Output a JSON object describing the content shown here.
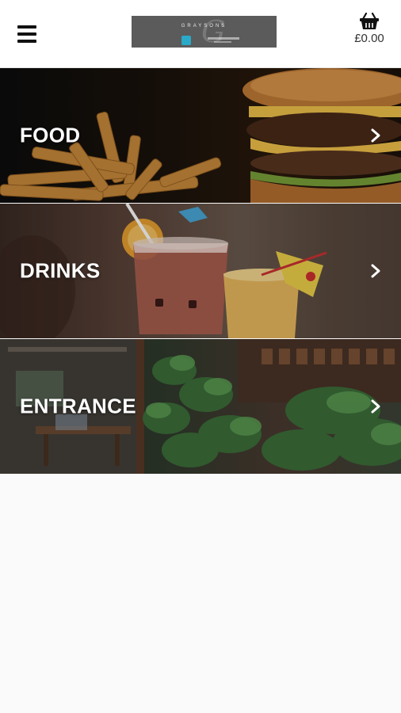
{
  "header": {
    "logo_name": "GRAYSONS",
    "logo_mark": "G",
    "basket_total": "£0.00"
  },
  "categories": [
    {
      "label": "FOOD",
      "icon": "chevron-right-icon"
    },
    {
      "label": "DRINKS",
      "icon": "chevron-right-icon"
    },
    {
      "label": "ENTRANCE",
      "icon": "chevron-right-icon"
    }
  ],
  "colors": {
    "header_bg": "#ffffff",
    "page_bg": "#fafafa",
    "logo_bg": "#5b5b5b",
    "logo_badge": "#2aa9c8",
    "tile_text": "#ffffff"
  }
}
